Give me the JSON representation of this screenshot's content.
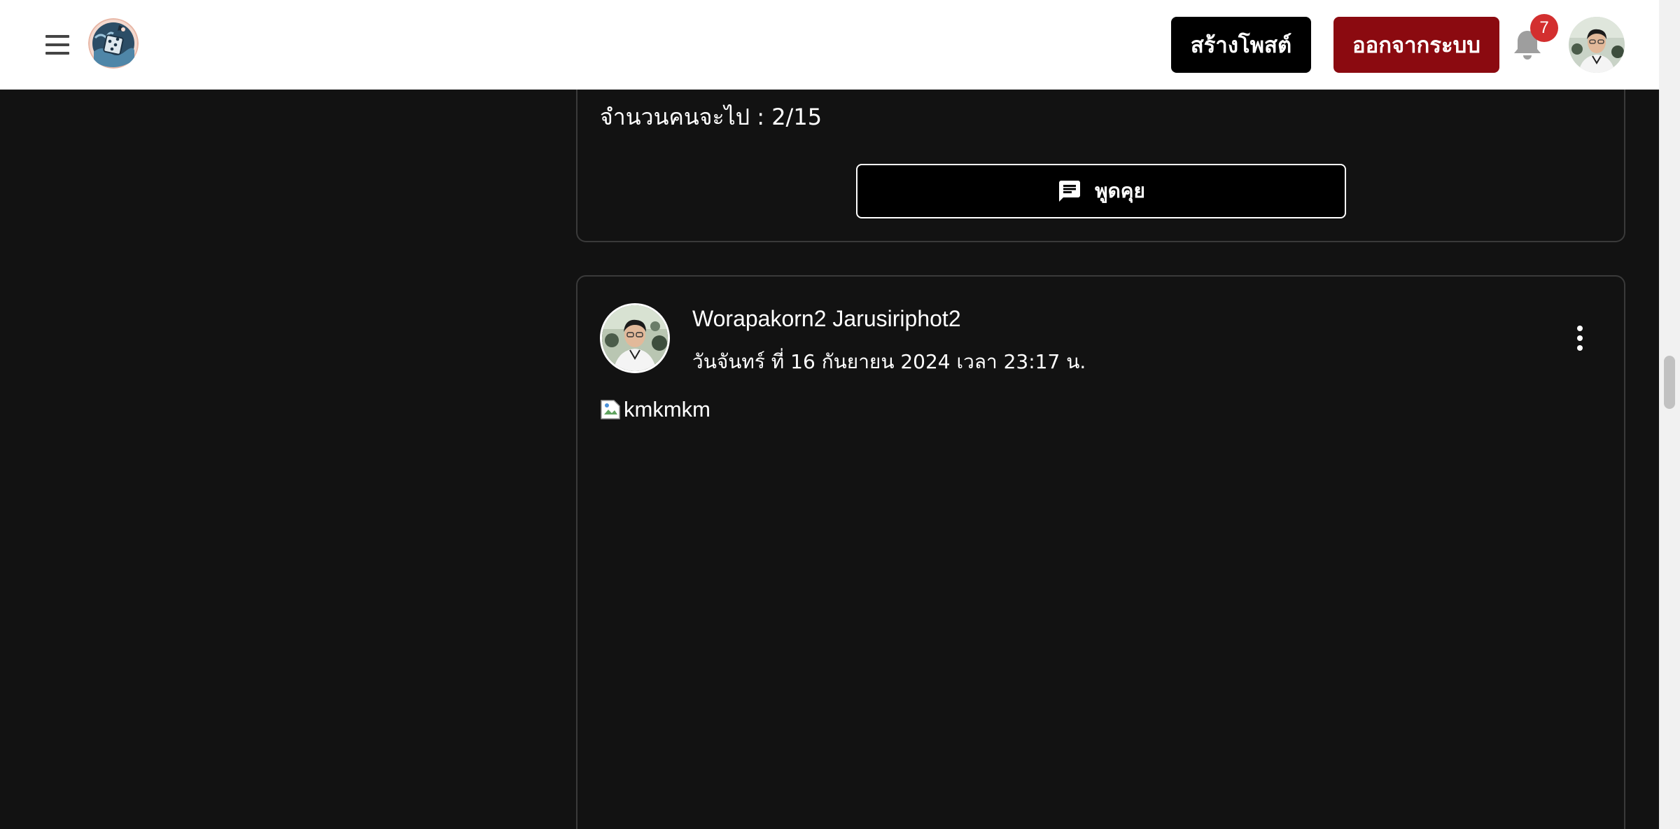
{
  "header": {
    "create_post_label": "สร้างโพสต์",
    "logout_label": "ออกจากระบบ",
    "notification_count": "7",
    "icons": {
      "menu": "hamburger-menu-icon",
      "logo": "dice-logo-icon",
      "bell": "bell-icon",
      "avatar": "user-avatar"
    }
  },
  "previous_post": {
    "people_going": "จำนวนคนจะไป : 2/15",
    "chat_label": "พูดคุย",
    "chat_icon": "chat-bubble-icon"
  },
  "post": {
    "author": "Worapakorn2 Jarusiriphot2",
    "date": "วันจันทร์ ที่ 16 กันยายน 2024 เวลา 23:17 น.",
    "image_alt": "kmkmkm",
    "more_icon": "more-vertical-icon"
  },
  "colors": {
    "background": "#121212",
    "header_bg": "#ffffff",
    "create_button": "#000000",
    "logout_button": "#8b0a10",
    "badge": "#d32f2f",
    "card_border": "#3a3a3a"
  }
}
